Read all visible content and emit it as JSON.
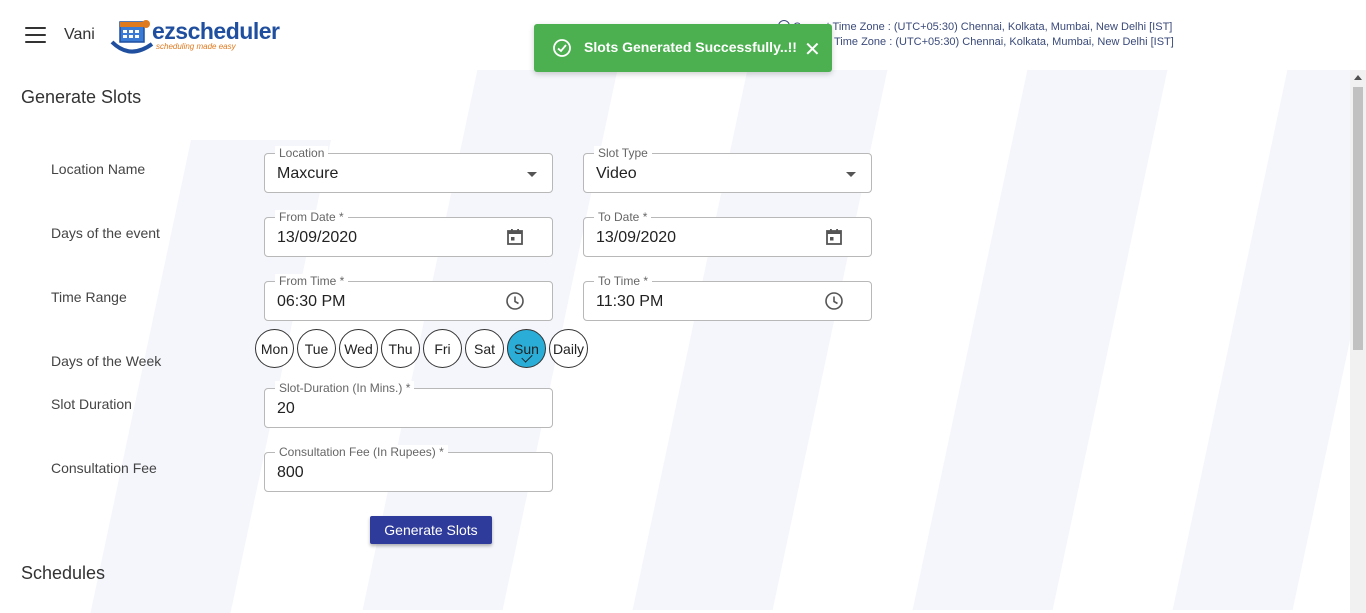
{
  "header": {
    "user_name": "Vani",
    "logo_text_ez": "ez",
    "logo_text_rest": "scheduler",
    "logo_tagline": "scheduling made easy",
    "timezone_line1": "Current Time Zone : (UTC+05:30) Chennai, Kolkata, Mumbai, New Delhi [IST]",
    "timezone_line2": "Time Zone : (UTC+05:30) Chennai, Kolkata, Mumbai, New Delhi [IST]"
  },
  "toast": {
    "message": "Slots Generated Successfully..!!",
    "close": "✕",
    "color": "#4caf50"
  },
  "generate_section": {
    "title": "Generate Slots",
    "rows": {
      "location_name": "Location Name",
      "days_of_event": "Days of the event",
      "time_range": "Time Range",
      "days_of_week": "Days of the Week",
      "slot_duration": "Slot Duration",
      "consultation_fee": "Consultation Fee"
    },
    "fields": {
      "location": {
        "label": "Location",
        "value": "Maxcure"
      },
      "slot_type": {
        "label": "Slot Type",
        "value": "Video"
      },
      "from_date": {
        "label": "From Date *",
        "value": "13/09/2020"
      },
      "to_date": {
        "label": "To Date *",
        "value": "13/09/2020"
      },
      "from_time": {
        "label": "From Time *",
        "value": "06:30 PM"
      },
      "to_time": {
        "label": "To Time *",
        "value": "11:30 PM"
      },
      "slot_duration": {
        "label": "Slot-Duration (In Mins.) *",
        "value": "20"
      },
      "consultation_fee": {
        "label": "Consultation Fee (In Rupees) *",
        "value": "800"
      }
    },
    "days": [
      {
        "label": "Mon",
        "selected": false
      },
      {
        "label": "Tue",
        "selected": false
      },
      {
        "label": "Wed",
        "selected": false
      },
      {
        "label": "Thu",
        "selected": false
      },
      {
        "label": "Fri",
        "selected": false
      },
      {
        "label": "Sat",
        "selected": false
      },
      {
        "label": "Sun",
        "selected": true
      },
      {
        "label": "Daily",
        "selected": false
      }
    ],
    "selected_day_color": "#2aaed8",
    "button_label": "Generate Slots",
    "button_color": "#2e3b9a"
  },
  "schedules_section": {
    "title": "Schedules"
  }
}
